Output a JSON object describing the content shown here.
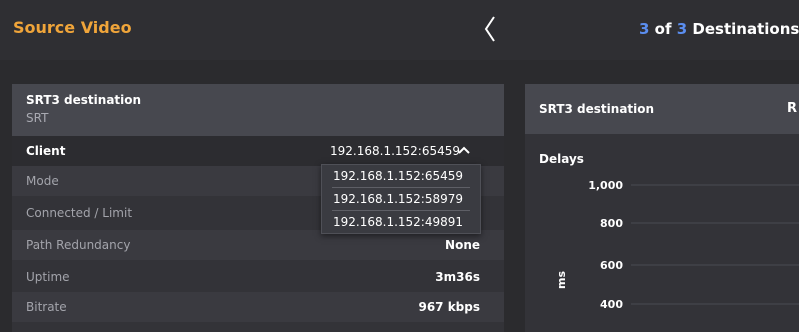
{
  "header": {
    "title": "Source Video",
    "destinations": {
      "current": "3",
      "of_text": "of",
      "total": "3",
      "label": "Destinations"
    }
  },
  "left_card": {
    "title": "SRT3 destination",
    "subtitle": "SRT",
    "client": {
      "label": "Client",
      "value": "192.168.1.152:65459"
    },
    "client_options": [
      "192.168.1.152:65459",
      "192.168.1.152:58979",
      "192.168.1.152:49891"
    ],
    "rows": [
      {
        "label": "Mode",
        "value": ""
      },
      {
        "label": "Connected / Limit",
        "value": ""
      },
      {
        "label": "Path Redundancy",
        "value": "None"
      },
      {
        "label": "Uptime",
        "value": "3m36s"
      },
      {
        "label": "Bitrate",
        "value": "967 kbps"
      }
    ]
  },
  "right_card": {
    "title": "SRT3 destination",
    "truncated_label": "R",
    "section_title": "Delays"
  },
  "chart_data": {
    "type": "line",
    "title": "Delays",
    "ylabel": "ms",
    "yticks": [
      "1,000",
      "800",
      "600",
      "400"
    ],
    "ytick_values": [
      1000,
      800,
      600,
      400
    ],
    "ylim": [
      400,
      1000
    ],
    "grid": true,
    "series": []
  },
  "colors": {
    "accent_orange": "#f0a53a",
    "accent_blue": "#5b8ef0",
    "background": "#2b2b2e",
    "panel": "#333338",
    "panel_header": "#47484f"
  }
}
